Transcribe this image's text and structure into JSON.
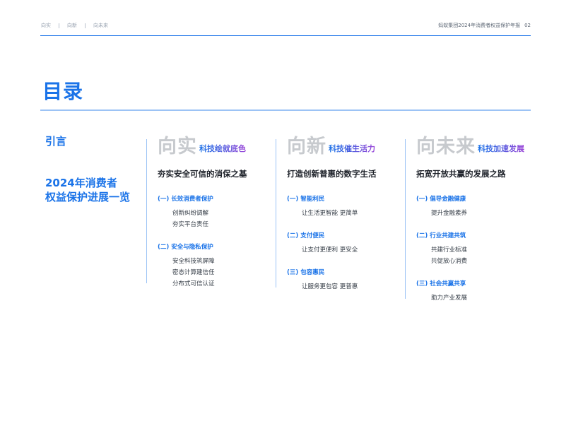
{
  "nav": {
    "items": [
      "向实",
      "向新",
      "向未来"
    ]
  },
  "report": {
    "title": "蚂蚁集团2024年消费者权益保护年报",
    "page": "02"
  },
  "title": "目录",
  "left": {
    "intro": "引言",
    "overview_line1": "2024年消费者",
    "overview_line2": "权益保护进展一览"
  },
  "columns": [
    {
      "big": "向实",
      "small": "科技绘就底色",
      "subtitle": "夯实安全可信的消保之基",
      "sections": [
        {
          "label": "(一) 长效消费者保护",
          "items": [
            "创新纠纷调解",
            "夯实平台责任"
          ]
        },
        {
          "label": "(二) 安全与隐私保护",
          "items": [
            "安全科技筑屏障",
            "密态计算建信任",
            "分布式可信认证"
          ]
        }
      ]
    },
    {
      "big": "向新",
      "small": "科技催生活力",
      "subtitle": "打造创新普惠的数字生活",
      "sections": [
        {
          "label": "(一) 智能利民",
          "items": [
            "让生活更智能 更简单"
          ]
        },
        {
          "label": "(二) 支付便民",
          "items": [
            "让支付更便利 更安全"
          ]
        },
        {
          "label": "(三) 包容惠民",
          "items": [
            "让服务更包容 更普惠"
          ]
        }
      ]
    },
    {
      "big": "向未来",
      "small": "科技加速发展",
      "subtitle": "拓宽开放共赢的发展之路",
      "sections": [
        {
          "label": "(一) 倡导金融健康",
          "items": [
            "提升金融素养"
          ]
        },
        {
          "label": "(二) 行业共建共筑",
          "items": [
            "共建行业标准",
            "共促放心消费"
          ]
        },
        {
          "label": "(三) 社会共赢共享",
          "items": [
            "助力产业发展"
          ]
        }
      ]
    }
  ]
}
